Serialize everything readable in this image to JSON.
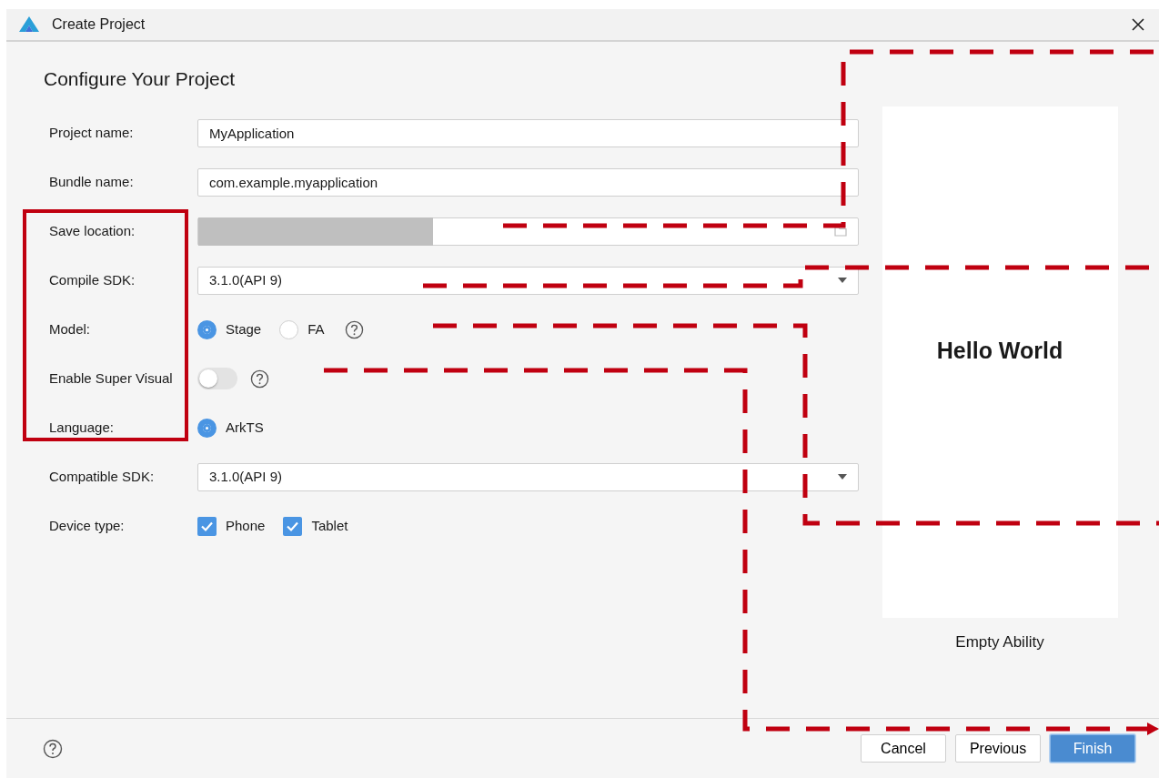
{
  "window": {
    "title": "Create Project"
  },
  "heading": "Configure Your Project",
  "fields": [
    {
      "kind": "text",
      "label": "Project name:",
      "value": "MyApplication"
    },
    {
      "kind": "text",
      "label": "Bundle name:",
      "value": "com.example.myapplication"
    },
    {
      "kind": "path",
      "label": "Save location:"
    },
    {
      "kind": "select",
      "label": "Compile SDK:",
      "value": "3.1.0(API 9)"
    },
    {
      "kind": "radio",
      "label": "Model:",
      "help": true,
      "options": [
        {
          "label": "Stage",
          "selected": true
        },
        {
          "label": "FA",
          "selected": false
        }
      ]
    },
    {
      "kind": "switch",
      "label": "Enable Super Visual",
      "help": true,
      "on": false
    },
    {
      "kind": "radio",
      "label": "Language:",
      "options": [
        {
          "label": "ArkTS",
          "selected": true
        }
      ]
    },
    {
      "kind": "select",
      "label": "Compatible SDK:",
      "value": "3.1.0(API 9)"
    },
    {
      "kind": "checkbox",
      "label": "Device type:",
      "options": [
        {
          "label": "Phone",
          "checked": true
        },
        {
          "label": "Tablet",
          "checked": true
        }
      ]
    }
  ],
  "preview": {
    "text": "Hello World",
    "caption": "Empty Ability"
  },
  "buttons": [
    {
      "label": "Cancel",
      "primary": false
    },
    {
      "label": "Previous",
      "primary": false
    },
    {
      "label": "Finish",
      "primary": true
    }
  ]
}
